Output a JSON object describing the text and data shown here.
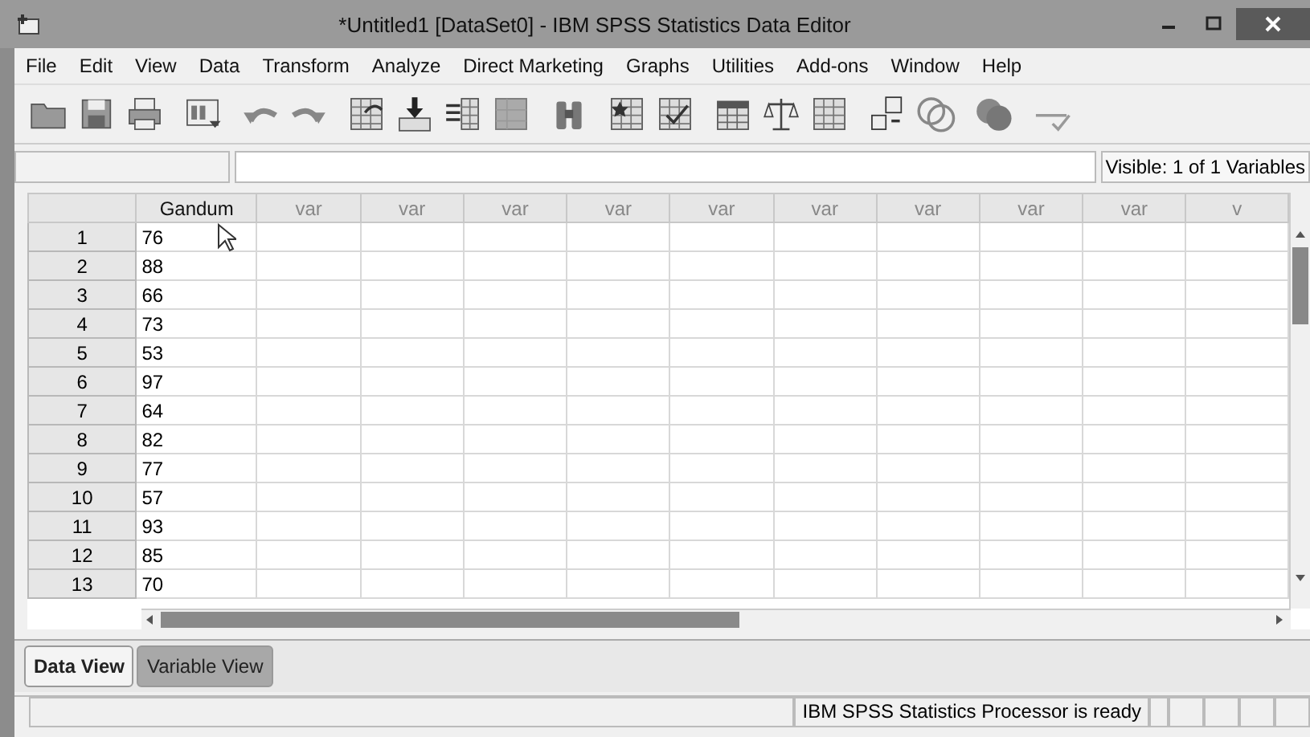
{
  "window": {
    "title": "*Untitled1 [DataSet0] - IBM SPSS Statistics Data Editor"
  },
  "menu": [
    "File",
    "Edit",
    "View",
    "Data",
    "Transform",
    "Analyze",
    "Direct Marketing",
    "Graphs",
    "Utilities",
    "Add-ons",
    "Window",
    "Help"
  ],
  "cell_bar": {
    "visible_info": "Visible: 1 of 1 Variables"
  },
  "table": {
    "columns": [
      {
        "label": "Gandum",
        "kind": "defined"
      },
      {
        "label": "var",
        "kind": "empty"
      },
      {
        "label": "var",
        "kind": "empty"
      },
      {
        "label": "var",
        "kind": "empty"
      },
      {
        "label": "var",
        "kind": "empty"
      },
      {
        "label": "var",
        "kind": "empty"
      },
      {
        "label": "var",
        "kind": "empty"
      },
      {
        "label": "var",
        "kind": "empty"
      },
      {
        "label": "var",
        "kind": "empty"
      },
      {
        "label": "var",
        "kind": "empty"
      },
      {
        "label": "v",
        "kind": "empty"
      }
    ],
    "rows": [
      {
        "number": "1",
        "values": [
          "76"
        ]
      },
      {
        "number": "2",
        "values": [
          "88"
        ]
      },
      {
        "number": "3",
        "values": [
          "66"
        ]
      },
      {
        "number": "4",
        "values": [
          "73"
        ]
      },
      {
        "number": "5",
        "values": [
          "53"
        ]
      },
      {
        "number": "6",
        "values": [
          "97"
        ]
      },
      {
        "number": "7",
        "values": [
          "64"
        ]
      },
      {
        "number": "8",
        "values": [
          "82"
        ]
      },
      {
        "number": "9",
        "values": [
          "77"
        ]
      },
      {
        "number": "10",
        "values": [
          "57"
        ]
      },
      {
        "number": "11",
        "values": [
          "93"
        ]
      },
      {
        "number": "12",
        "values": [
          "85"
        ]
      },
      {
        "number": "13",
        "values": [
          "70"
        ]
      }
    ]
  },
  "tabs": [
    {
      "label": "Data View",
      "selected": true
    },
    {
      "label": "Variable View",
      "selected": false
    }
  ],
  "status_bar": {
    "message": "IBM SPSS Statistics Processor is ready"
  }
}
